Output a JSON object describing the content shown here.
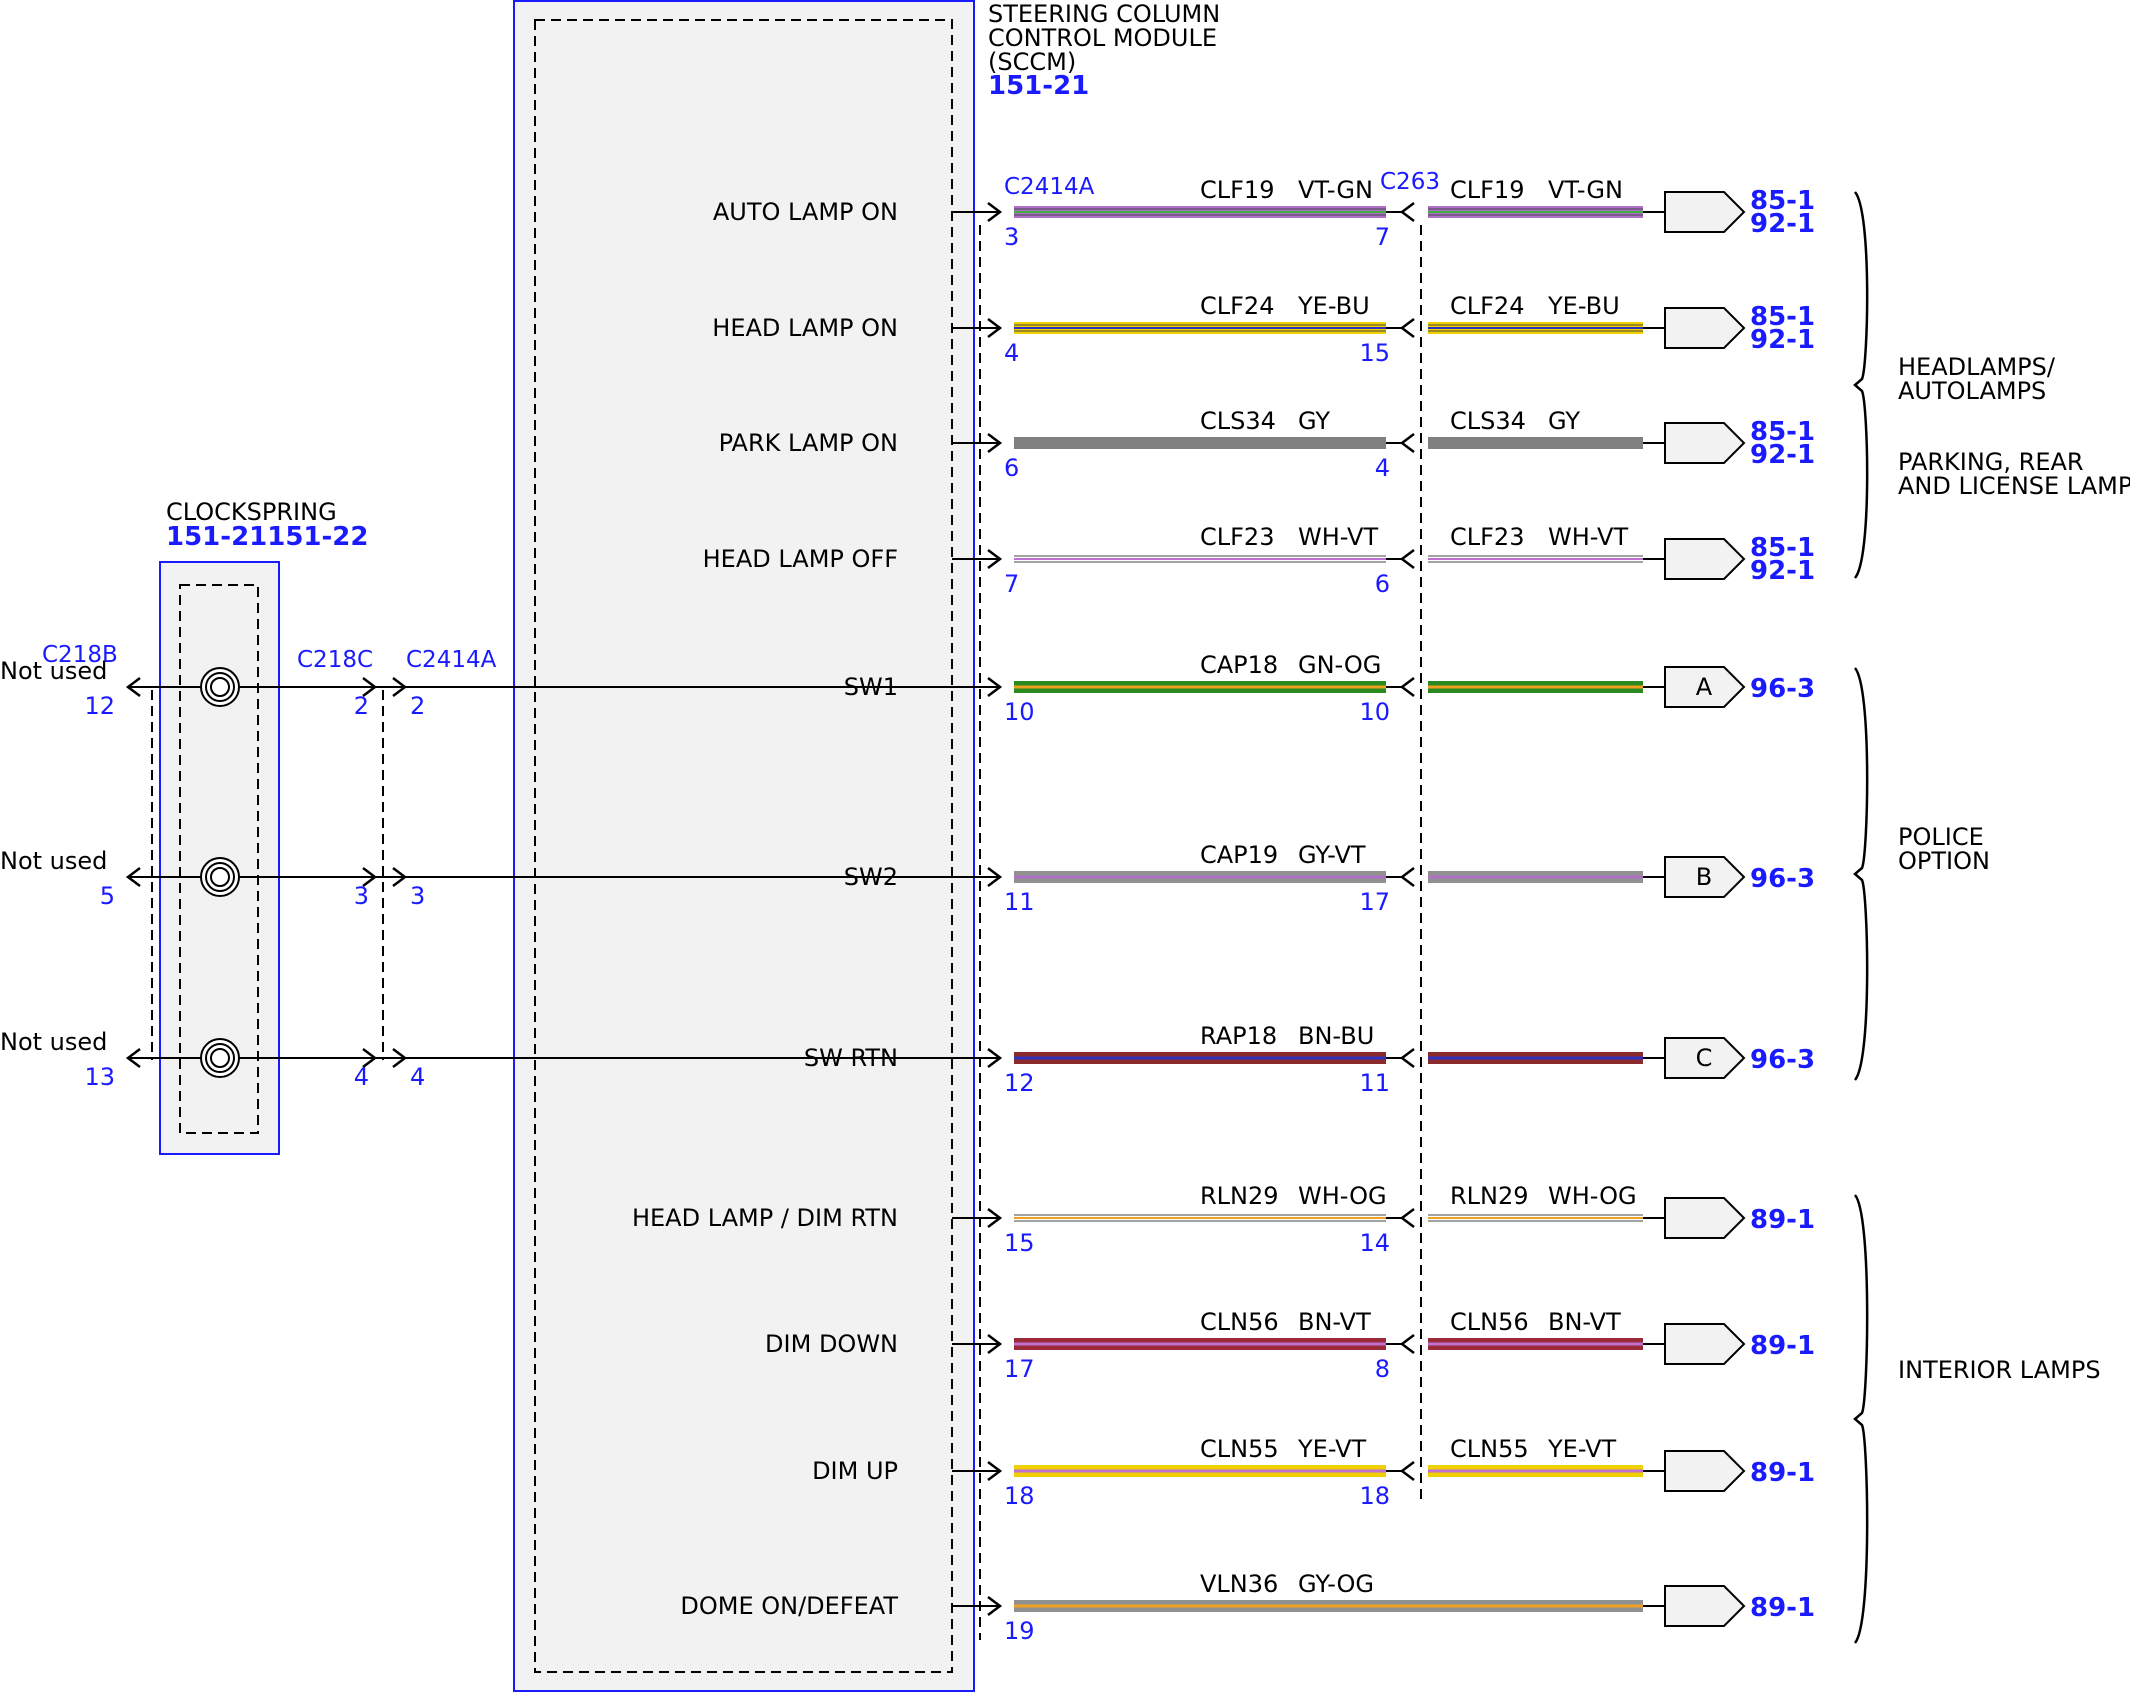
{
  "module": {
    "title_lines": [
      "STEERING COLUMN",
      "CONTROL MODULE",
      "(SCCM)"
    ],
    "ref": "151-21"
  },
  "clockspring": {
    "title": "CLOCKSPRING",
    "ref": "151-21151-22",
    "left_connector": "C218B",
    "right_connector": "C218C",
    "sccm_connector": "C2414A"
  },
  "connectors": {
    "sccm_right": "C2414A",
    "inline": "C263"
  },
  "circuits": [
    {
      "func": "AUTO LAMP ON",
      "circuit": "CLF19",
      "color": "VT-GN",
      "pin_a": "3",
      "pin_b": "7",
      "circuit2": "CLF19",
      "color2": "VT-GN",
      "refs": [
        "85-1",
        "92-1"
      ],
      "conn": "",
      "wire_base": "#b070c8",
      "wire_stripe": "#40b040",
      "thin": true
    },
    {
      "func": "HEAD LAMP ON",
      "circuit": "CLF24",
      "color": "YE-BU",
      "pin_a": "4",
      "pin_b": "15",
      "circuit2": "CLF24",
      "color2": "YE-BU",
      "refs": [
        "85-1",
        "92-1"
      ],
      "conn": "",
      "wire_base": "#f0d000",
      "wire_stripe": "#3030c0",
      "thin": true
    },
    {
      "func": "PARK LAMP ON",
      "circuit": "CLS34",
      "color": "GY",
      "pin_a": "6",
      "pin_b": "4",
      "circuit2": "CLS34",
      "color2": "GY",
      "refs": [
        "85-1",
        "92-1"
      ],
      "conn": "",
      "wire_base": "#808080",
      "wire_stripe": "#808080",
      "thin": false
    },
    {
      "func": "HEAD LAMP OFF",
      "circuit": "CLF23",
      "color": "WH-VT",
      "pin_a": "7",
      "pin_b": "6",
      "circuit2": "CLF23",
      "color2": "WH-VT",
      "refs": [
        "85-1",
        "92-1"
      ],
      "conn": "",
      "wire_base": "#ffffff",
      "wire_stripe": "#c070d0",
      "thin": true
    },
    {
      "func": "SW1",
      "circuit": "CAP18",
      "color": "GN-OG",
      "pin_a": "10",
      "pin_b": "10",
      "circuit2": "",
      "color2": "",
      "refs": [
        "96-3"
      ],
      "conn": "A",
      "wire_base": "#2a8a20",
      "wire_stripe": "#f0a020",
      "thin": false
    },
    {
      "func": "SW2",
      "circuit": "CAP19",
      "color": "GY-VT",
      "pin_a": "11",
      "pin_b": "17",
      "circuit2": "",
      "color2": "",
      "refs": [
        "96-3"
      ],
      "conn": "B",
      "wire_base": "#909090",
      "wire_stripe": "#b070c8",
      "thin": false
    },
    {
      "func": "SW RTN",
      "circuit": "RAP18",
      "color": "BN-BU",
      "pin_a": "12",
      "pin_b": "11",
      "circuit2": "",
      "color2": "",
      "refs": [
        "96-3"
      ],
      "conn": "C",
      "wire_base": "#8a2a2a",
      "wire_stripe": "#3030c0",
      "thin": false
    },
    {
      "func": "HEAD LAMP / DIM RTN",
      "circuit": "RLN29",
      "color": "WH-OG",
      "pin_a": "15",
      "pin_b": "14",
      "circuit2": "RLN29",
      "color2": "WH-OG",
      "refs": [
        "89-1"
      ],
      "conn": "",
      "wire_base": "#ffffff",
      "wire_stripe": "#f0a020",
      "thin": true
    },
    {
      "func": "DIM DOWN",
      "circuit": "CLN56",
      "color": "BN-VT",
      "pin_a": "17",
      "pin_b": "8",
      "circuit2": "CLN56",
      "color2": "BN-VT",
      "refs": [
        "89-1"
      ],
      "conn": "",
      "wire_base": "#9a2a3a",
      "wire_stripe": "#c070d0",
      "thin": false
    },
    {
      "func": "DIM UP",
      "circuit": "CLN55",
      "color": "YE-VT",
      "pin_a": "18",
      "pin_b": "18",
      "circuit2": "CLN55",
      "color2": "YE-VT",
      "refs": [
        "89-1"
      ],
      "conn": "",
      "wire_base": "#f0d000",
      "wire_stripe": "#c070d0",
      "thin": false
    },
    {
      "func": "DOME ON/DEFEAT",
      "circuit": "VLN36",
      "color": "GY-OG",
      "pin_a": "19",
      "pin_b": "",
      "circuit2": "",
      "color2": "",
      "refs": [
        "89-1"
      ],
      "conn": "",
      "wire_base": "#909090",
      "wire_stripe": "#f0a020",
      "thin": false
    }
  ],
  "clockspring_rows": [
    {
      "not_used": "Not used",
      "left_pin": "12",
      "right_pin": "2",
      "sccm_pin": "2"
    },
    {
      "not_used": "Not used",
      "left_pin": "5",
      "right_pin": "3",
      "sccm_pin": "3"
    },
    {
      "not_used": "Not used",
      "left_pin": "13",
      "right_pin": "4",
      "sccm_pin": "4"
    }
  ],
  "groups": [
    {
      "lines": [
        "HEADLAMPS/",
        "AUTOLAMPS"
      ]
    },
    {
      "lines": [
        "PARKING, REAR",
        "AND LICENSE LAMPS"
      ]
    },
    {
      "lines": [
        "POLICE",
        "OPTION"
      ]
    },
    {
      "lines": [
        "INTERIOR LAMPS"
      ]
    }
  ]
}
